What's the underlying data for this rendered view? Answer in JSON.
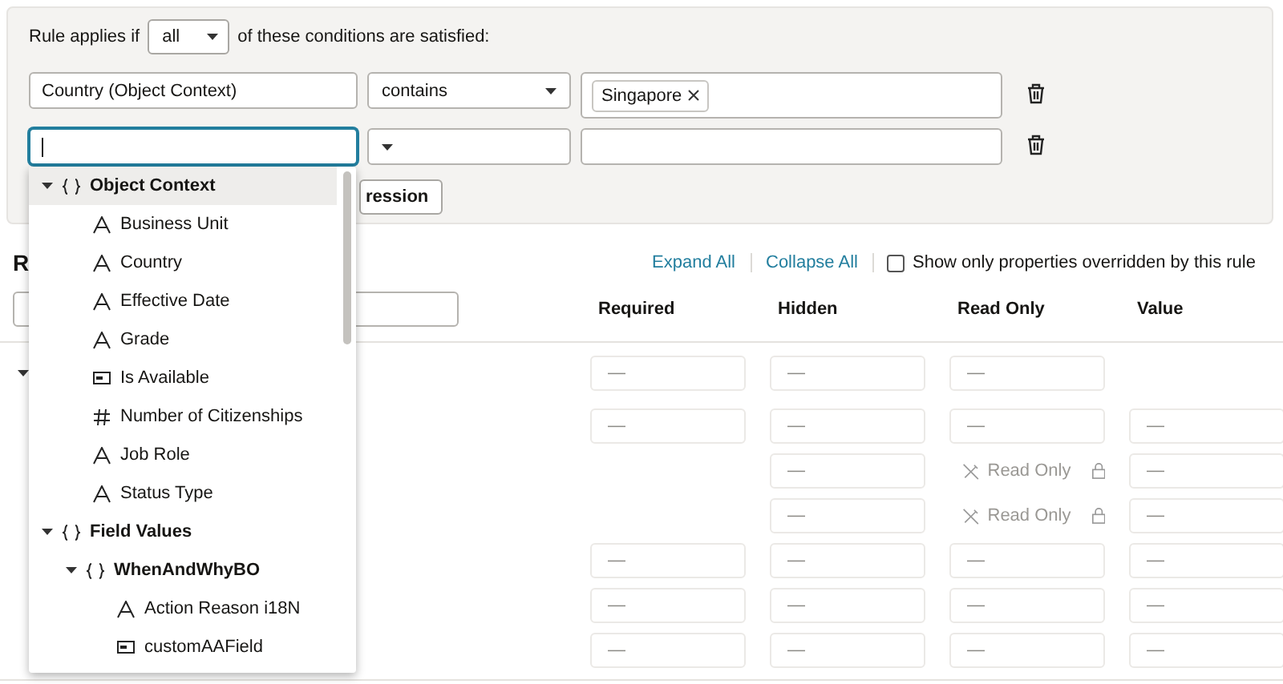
{
  "rule_header": {
    "prefix": "Rule applies if",
    "match_select": {
      "value": "all"
    },
    "suffix": "of these conditions are satisfied:"
  },
  "conditions": [
    {
      "field": {
        "value": "Country (Object Context)",
        "focused": false
      },
      "operator": {
        "value": "contains"
      },
      "values": {
        "tokens": [
          "Singapore"
        ]
      }
    },
    {
      "field": {
        "focused": true
      }
    }
  ],
  "add_button": {
    "label": "ression"
  },
  "section_title": "R",
  "toolbar": {
    "links": [
      "Expand All",
      "Collapse All"
    ],
    "checkbox": {
      "label": "Show only properties overridden by this rule",
      "checked": false
    }
  },
  "columns": [
    "Required",
    "Hidden",
    "Read Only",
    "Value"
  ],
  "rows": [
    {
      "expanded": true,
      "cells": [
        {
          "kind": "dash",
          "text": "—"
        },
        {
          "kind": "dash",
          "text": "—"
        },
        {
          "kind": "dash",
          "text": "—"
        },
        {
          "kind": "empty"
        }
      ]
    },
    {
      "cells": [
        {
          "kind": "dash",
          "text": "—"
        },
        {
          "kind": "dash",
          "text": "—"
        },
        {
          "kind": "dash",
          "text": "—"
        },
        {
          "kind": "dash",
          "text": "—"
        }
      ]
    },
    {
      "cells": [
        {
          "kind": "empty"
        },
        {
          "kind": "dash",
          "text": "—"
        },
        {
          "kind": "readonly",
          "text": "Read Only"
        },
        {
          "kind": "dash",
          "text": "—"
        }
      ]
    },
    {
      "cells": [
        {
          "kind": "empty"
        },
        {
          "kind": "dash",
          "text": "—"
        },
        {
          "kind": "readonly",
          "text": "Read Only"
        },
        {
          "kind": "dash",
          "text": "—"
        }
      ]
    },
    {
      "cells": [
        {
          "kind": "dash",
          "text": "—"
        },
        {
          "kind": "dash",
          "text": "—"
        },
        {
          "kind": "dash",
          "text": "—"
        },
        {
          "kind": "dash",
          "text": "—"
        }
      ]
    },
    {
      "cells": [
        {
          "kind": "dash",
          "text": "—"
        },
        {
          "kind": "dash",
          "text": "—"
        },
        {
          "kind": "dash",
          "text": "—"
        },
        {
          "kind": "dash",
          "text": "—"
        }
      ]
    },
    {
      "cells": [
        {
          "kind": "dash",
          "text": "—"
        },
        {
          "kind": "dash",
          "text": "—"
        },
        {
          "kind": "dash",
          "text": "—"
        },
        {
          "kind": "dash",
          "text": "—"
        }
      ]
    }
  ],
  "dropdown": {
    "items": [
      {
        "kind": "group",
        "label": "Object Context",
        "expanded": true,
        "selected": true,
        "children": [
          {
            "kind": "text",
            "label": "Business Unit",
            "selected": false
          },
          {
            "kind": "text",
            "label": "Country",
            "selected": false
          },
          {
            "kind": "text",
            "label": "Effective Date",
            "selected": false
          },
          {
            "kind": "text",
            "label": "Grade",
            "selected": false
          },
          {
            "kind": "field",
            "label": "Is Available",
            "selected": false
          },
          {
            "kind": "number",
            "label": "Number of Citizenships",
            "selected": false
          },
          {
            "kind": "text",
            "label": "Job Role",
            "selected": false
          },
          {
            "kind": "text",
            "label": "Status Type",
            "selected": false
          }
        ]
      },
      {
        "kind": "group",
        "label": "Field Values",
        "expanded": true,
        "selected": false,
        "children": [
          {
            "kind": "group",
            "label": "WhenAndWhyBO",
            "expanded": true,
            "selected": false,
            "children": [
              {
                "kind": "text",
                "label": "Action Reason i18N",
                "selected": false
              },
              {
                "kind": "field",
                "label": "customAAField",
                "selected": false
              }
            ]
          }
        ]
      }
    ]
  }
}
